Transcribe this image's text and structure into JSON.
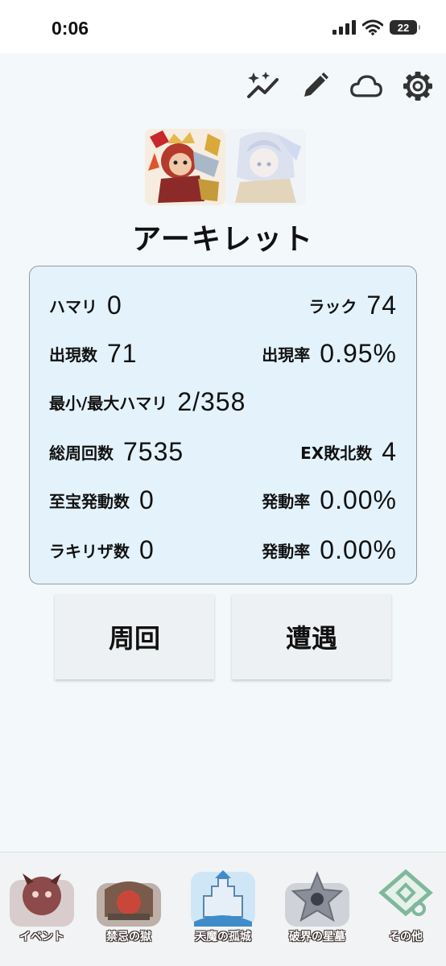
{
  "status_bar": {
    "time": "0:06",
    "battery": "22"
  },
  "toolbar": {
    "icons": [
      "sparkle-chart-icon",
      "pencil-icon",
      "cloud-icon",
      "gear-icon"
    ]
  },
  "character": {
    "name": "アーキレット"
  },
  "stats": {
    "hamari_label": "ハマリ",
    "hamari_value": "0",
    "luck_label": "ラック",
    "luck_value": "74",
    "appear_count_label": "出現数",
    "appear_count_value": "71",
    "appear_rate_label": "出現率",
    "appear_rate_value": "0.95%",
    "minmax_label": "最小/最大ハマリ",
    "minmax_value": "2/358",
    "total_runs_label": "総周回数",
    "total_runs_value": "7535",
    "ex_defeat_label": "EX敗北数",
    "ex_defeat_value": "4",
    "treasure_label": "至宝発動数",
    "treasure_value": "0",
    "treasure_rate_label": "発動率",
    "treasure_rate_value": "0.00%",
    "lucky_label": "ラキリザ数",
    "lucky_value": "0",
    "lucky_rate_label": "発動率",
    "lucky_rate_value": "0.00%"
  },
  "actions": {
    "run_label": "周回",
    "encounter_label": "遭遇"
  },
  "tabs": [
    {
      "label": "イベント",
      "color": "#8c4a4a"
    },
    {
      "label": "禁忌の獄",
      "color": "#7a5a4a"
    },
    {
      "label": "天魔の孤城",
      "color": "#3f8cc8"
    },
    {
      "label": "破界の星墓",
      "color": "#8a8e99"
    },
    {
      "label": "その他",
      "color": "#7fb89c"
    }
  ]
}
